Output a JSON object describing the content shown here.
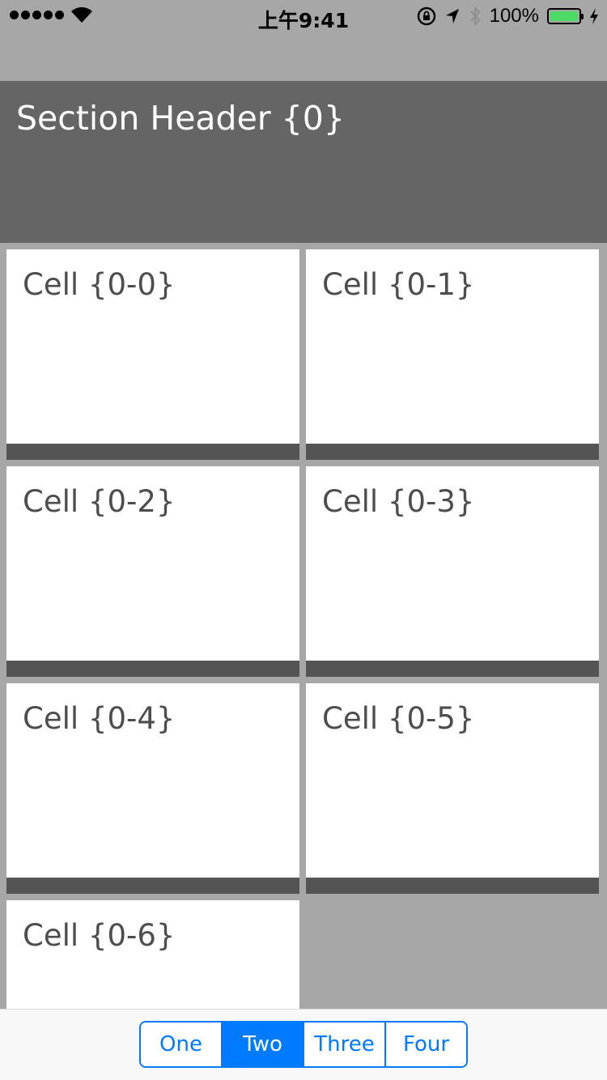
{
  "status_bar": {
    "time": "上午9:41",
    "battery_percent": "100%",
    "battery_color": "#4cd964",
    "icons": [
      "signal-dots-icon",
      "wifi-icon",
      "orientation-lock-icon",
      "location-arrow-icon",
      "bluetooth-icon",
      "battery-icon",
      "charging-bolt-icon"
    ]
  },
  "section": {
    "title": "Section Header {0}"
  },
  "cells": [
    {
      "label": "Cell {0-0}"
    },
    {
      "label": "Cell {0-1}"
    },
    {
      "label": "Cell {0-2}"
    },
    {
      "label": "Cell {0-3}"
    },
    {
      "label": "Cell {0-4}"
    },
    {
      "label": "Cell {0-5}"
    },
    {
      "label": "Cell {0-6}"
    }
  ],
  "segmented_control": {
    "segments": [
      "One",
      "Two",
      "Three",
      "Four"
    ],
    "selected": "Two",
    "accent_color": "#007aff"
  },
  "colors": {
    "background": "#a7a7a7",
    "header_background": "#656565",
    "cell_background": "#ffffff",
    "cell_footer_bar": "#545454"
  }
}
